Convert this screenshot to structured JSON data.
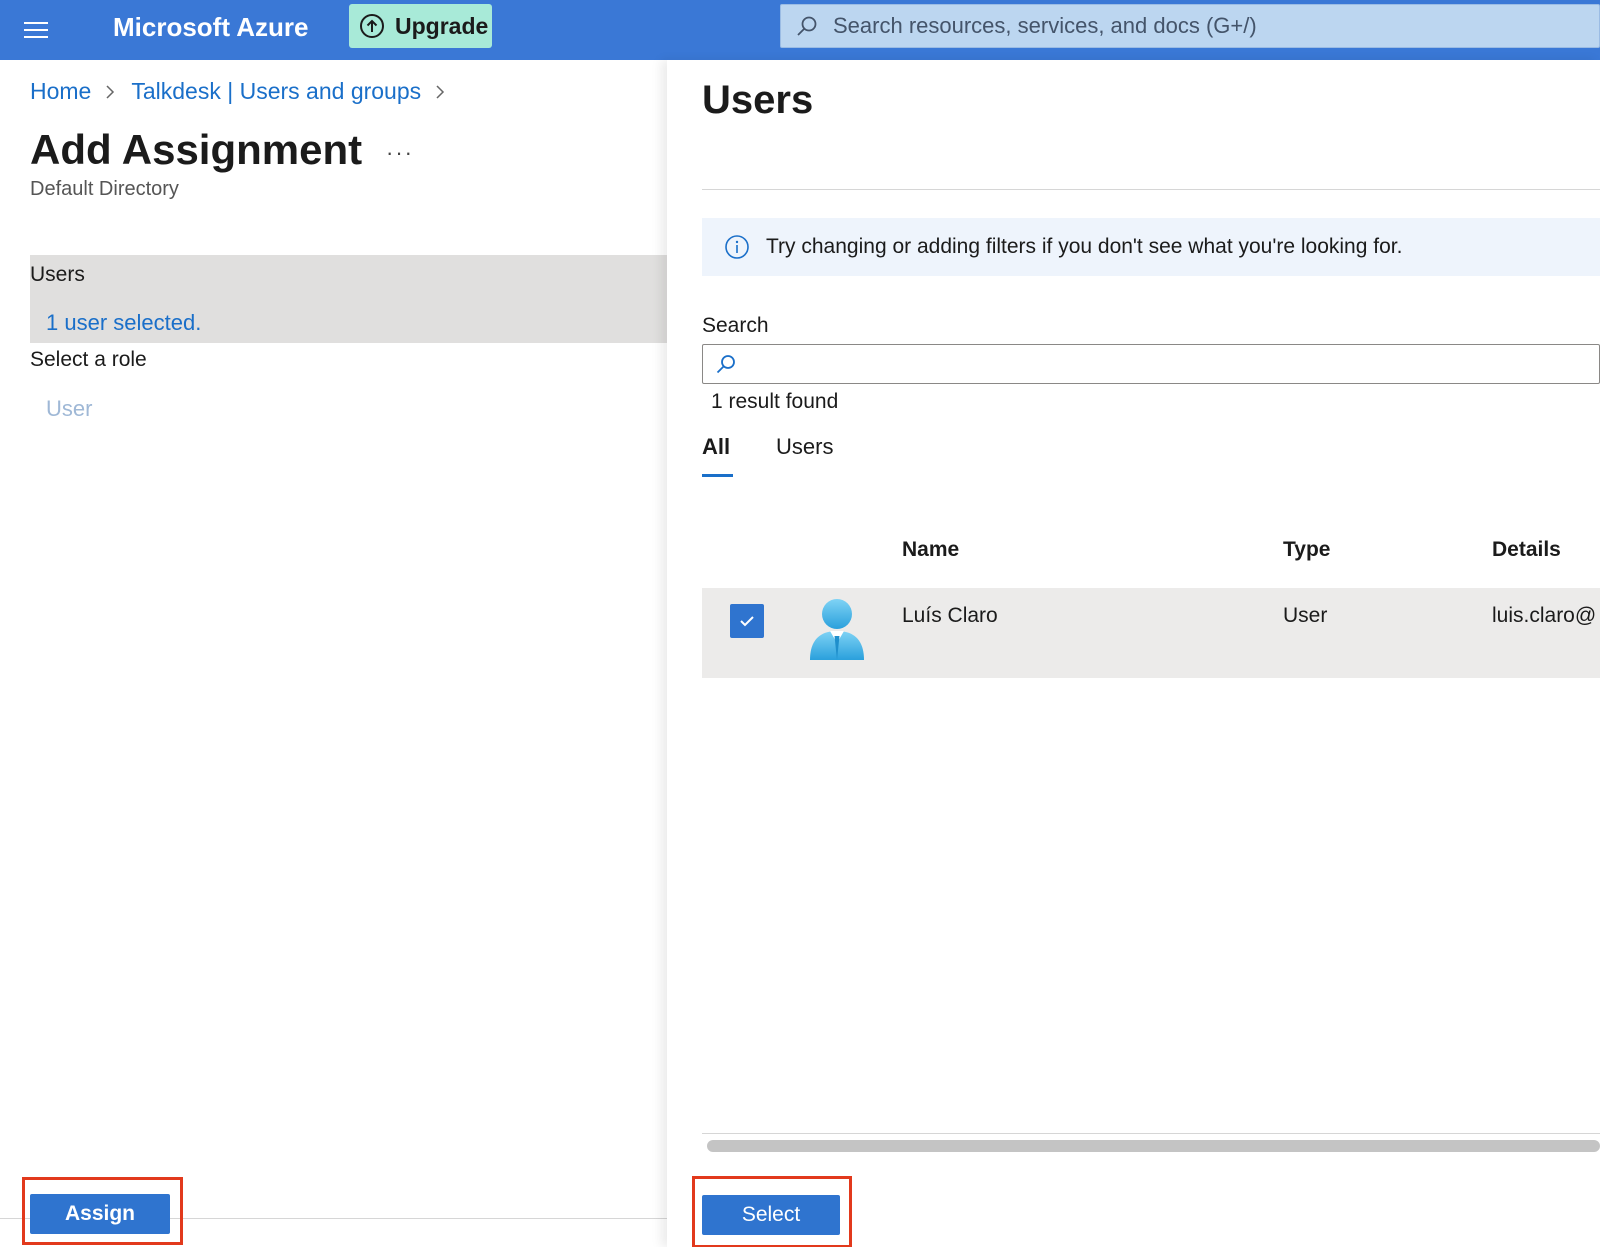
{
  "topbar": {
    "brand": "Microsoft Azure",
    "upgrade_label": "Upgrade",
    "search_placeholder": "Search resources, services, and docs (G+/)",
    "background_color": "#3a78d6"
  },
  "left_blade": {
    "breadcrumb": [
      "Home",
      "Talkdesk | Users and groups"
    ],
    "title": "Add Assignment",
    "more_label": "···",
    "subtitle": "Default Directory",
    "users_section_label": "Users",
    "users_selected": "1 user selected.",
    "role_label": "Select a role",
    "role_value": "User",
    "assign_label": "Assign"
  },
  "right_blade": {
    "title": "Users",
    "info_text": "Try changing or adding filters if you don't see what you're looking for.",
    "search_label": "Search",
    "search_value": "",
    "result_count": "1 result found",
    "tabs": [
      {
        "label": "All",
        "active": true
      },
      {
        "label": "Users",
        "active": false
      }
    ],
    "columns": [
      "Name",
      "Type",
      "Details"
    ],
    "rows": [
      {
        "name": "Luís Claro",
        "type": "User",
        "details": "luis.claro@",
        "selected": true,
        "icon": "user-avatar-icon"
      }
    ],
    "select_label": "Select"
  },
  "colors": {
    "accent": "#2f74cf",
    "link": "#1a6fc9",
    "highlight_box": "#e2391c",
    "upgrade_bg": "#a8ead8"
  }
}
